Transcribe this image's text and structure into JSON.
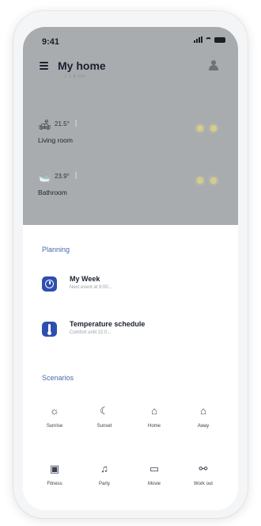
{
  "status_bar": {
    "time": "9:41"
  },
  "header": {
    "title": "My home",
    "subtitle": "1 1 4 mm"
  },
  "rooms": [
    {
      "icon": "sofa-icon",
      "glyph": "🛋",
      "temperature": "21.5°",
      "name": "Living room"
    },
    {
      "icon": "bath-icon",
      "glyph": "🛁",
      "temperature": "23.9°",
      "name": "Bathroom"
    }
  ],
  "planning": {
    "title": "Planning",
    "items": [
      {
        "title": "My Week",
        "subtitle": "Next event at 9:00...",
        "icon": "clock-icon"
      },
      {
        "title": "Temperature schedule",
        "subtitle": "Comfort until 22:0...",
        "icon": "thermometer-icon"
      }
    ]
  },
  "scenarios": {
    "title": "Scenarios",
    "items": [
      {
        "label": "Sunrise",
        "icon": "sunrise-icon",
        "glyph": "☼"
      },
      {
        "label": "Sunset",
        "icon": "moon-icon",
        "glyph": "☾"
      },
      {
        "label": "Home",
        "icon": "home-icon",
        "glyph": "⌂"
      },
      {
        "label": "Away",
        "icon": "away-icon",
        "glyph": "⌂"
      },
      {
        "label": "Fitness",
        "icon": "briefcase-icon",
        "glyph": "▣"
      },
      {
        "label": "Party",
        "icon": "party-icon",
        "glyph": "♫"
      },
      {
        "label": "Movie",
        "icon": "tv-icon",
        "glyph": "▭"
      },
      {
        "label": "Work out",
        "icon": "dumbbell-icon",
        "glyph": "⚯"
      }
    ]
  },
  "colors": {
    "accent": "#2e4fb0",
    "section_title": "#4a69a8",
    "overlay": "#a9acae"
  }
}
